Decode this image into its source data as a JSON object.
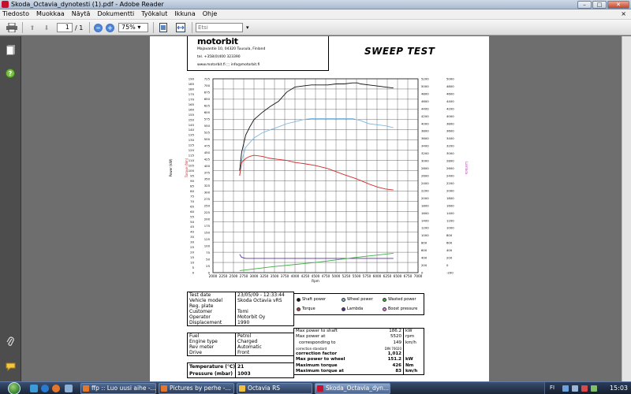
{
  "window": {
    "title": "Skoda_Octavia_dynotesti (1).pdf - Adobe Reader",
    "min": "–",
    "max": "□",
    "close": "✕"
  },
  "menubar": {
    "items": [
      "Tiedosto",
      "Muokkaa",
      "Näytä",
      "Dokumentti",
      "Työkalut",
      "Ikkuna",
      "Ohje"
    ],
    "close": "×"
  },
  "toolbar": {
    "page_current": "1",
    "page_total": "/ 1",
    "zoom": "75%",
    "search_placeholder": "Etsi"
  },
  "doc": {
    "logo": "motorbit",
    "address": "Majavantie 10, 04320 Tuusula, Finland",
    "phone": "tel. +358(0)400 323390",
    "web": "www.motorbit.fi  ⬚  info@motorbit.fi",
    "sweep_title": "SWEEP TEST"
  },
  "chart_data": {
    "type": "line",
    "xlabel": "Rpm",
    "x_ticks": [
      2000,
      2250,
      2500,
      2750,
      3000,
      3250,
      3500,
      3750,
      4000,
      4250,
      4500,
      4750,
      5000,
      5250,
      5500,
      5750,
      6000,
      6250,
      6500,
      6750,
      7000
    ],
    "xlim": [
      2000,
      7000
    ],
    "y1_label": "Power (kW)",
    "y1_ticks": [
      0,
      5,
      10,
      15,
      20,
      25,
      30,
      35,
      40,
      45,
      50,
      55,
      60,
      65,
      70,
      75,
      80,
      85,
      90,
      95,
      100,
      105,
      110,
      115,
      120,
      125,
      130,
      135,
      140,
      145,
      150,
      155,
      160,
      165,
      170,
      175,
      180,
      185,
      190
    ],
    "y2_label": "Torque (Nm)",
    "y2_ticks": [
      0,
      25,
      50,
      75,
      100,
      125,
      150,
      175,
      200,
      225,
      250,
      275,
      300,
      325,
      350,
      375,
      400,
      425,
      450,
      475,
      500,
      525,
      550,
      575,
      600,
      625,
      650,
      675,
      700,
      725
    ],
    "y3_ticks": [
      5200,
      5000,
      4800,
      4600,
      4400,
      4200,
      4000,
      3800,
      3600,
      3400,
      3200,
      3000,
      2800,
      2600,
      2400,
      2200,
      2000,
      1800,
      1600,
      1400,
      1200,
      1000,
      800,
      600,
      400,
      200,
      0
    ],
    "y4_label": "Lambda",
    "y4_ticks": [
      5000,
      4800,
      4600,
      4400,
      4200,
      4000,
      3800,
      3600,
      3400,
      3200,
      3000,
      2800,
      2600,
      2400,
      2200,
      2000,
      1800,
      1600,
      1400,
      1200,
      1000,
      800,
      600,
      400,
      200,
      0,
      -200
    ],
    "ylim": [
      0,
      190
    ],
    "series": [
      {
        "name": "Shaft power",
        "color": "#111111",
        "x": [
          2650,
          2700,
          2800,
          2900,
          3000,
          3200,
          3400,
          3600,
          3800,
          4000,
          4200,
          4400,
          4600,
          4800,
          5000,
          5200,
          5400,
          5520,
          5600,
          5800,
          6000,
          6200,
          6400
        ],
        "y": [
          100,
          118,
          135,
          143,
          150,
          157,
          163,
          168,
          177,
          182,
          183,
          184,
          184,
          184,
          185,
          185,
          186,
          186,
          185,
          184,
          183,
          182,
          181
        ]
      },
      {
        "name": "Wheel power",
        "color": "#7fb8de",
        "x": [
          2650,
          2700,
          2800,
          3000,
          3200,
          3400,
          3600,
          3800,
          4000,
          4200,
          4400,
          4600,
          4800,
          5000,
          5200,
          5400,
          5600,
          5800,
          6000,
          6200,
          6400
        ],
        "y": [
          95,
          110,
          123,
          132,
          137,
          140,
          143,
          146,
          148,
          150,
          151,
          151,
          151,
          151,
          151,
          151,
          149,
          146,
          145,
          144,
          142
        ]
      },
      {
        "name": "Torque",
        "color": "#d42a2a",
        "x": [
          2650,
          2700,
          2800,
          2900,
          3000,
          3200,
          3400,
          3600,
          3800,
          4000,
          4200,
          4500,
          4800,
          5000,
          5200,
          5500,
          5800,
          6000,
          6200,
          6400
        ],
        "y": [
          95,
          108,
          112,
          114,
          115,
          114,
          112,
          111,
          110,
          108,
          107,
          105,
          102,
          99,
          96,
          92,
          87,
          84,
          82,
          81
        ]
      },
      {
        "name": "Lambda",
        "color": "#5a2fa0",
        "x": [
          2650,
          2700,
          2800,
          3000,
          3500,
          4000,
          5000,
          6000,
          6400
        ],
        "y": [
          18,
          15,
          14,
          14,
          14,
          14,
          14,
          14,
          14
        ]
      },
      {
        "name": "Wasted power",
        "color": "#3fae3f",
        "x": [
          2650,
          3500,
          4500,
          5500,
          6400
        ],
        "y": [
          2,
          6,
          10,
          15,
          19
        ]
      }
    ]
  },
  "legend": {
    "shaft": "Shaft power",
    "wheel": "Wheel power",
    "wasted": "Wasted power",
    "torque": "Torque",
    "lambda": "Lambda",
    "boost": "Boost pressure"
  },
  "info": {
    "rows": [
      {
        "k": "Test date",
        "v": "23/05/09 - 12:33:44"
      },
      {
        "k": "Vehicle model",
        "v": "Skoda Octavia vRS"
      },
      {
        "k": "Reg. plate",
        "v": ""
      },
      {
        "k": "Customer",
        "v": "Tomi"
      },
      {
        "k": "Operator",
        "v": "Motorbit Oy"
      },
      {
        "k": "Displacement",
        "v": "1990"
      }
    ],
    "rows2": [
      {
        "k": "Fuel",
        "v": "Petrol"
      },
      {
        "k": "Engine type",
        "v": "Charged"
      },
      {
        "k": "Rev meter",
        "v": "Automatic"
      },
      {
        "k": "Drive",
        "v": "Front"
      }
    ],
    "rows3": [
      {
        "k": "Temperature (°C)",
        "v": "21"
      },
      {
        "k": "Pressure (mbar)",
        "v": "1003"
      }
    ]
  },
  "summary": {
    "rows": [
      {
        "k": "Max power to shaft",
        "v": "186.2",
        "u": "kW"
      },
      {
        "k": "Max power at",
        "v": "5520",
        "u": "rpm"
      },
      {
        "k": "corresponding to",
        "v": "149",
        "u": "km/h"
      },
      {
        "k": "correction standard",
        "v": "DIN 70020",
        "u": ""
      },
      {
        "k": "correction factor",
        "v": "1,012",
        "u": ""
      },
      {
        "k": "Max power to wheel",
        "v": "151.2",
        "u": "kW"
      },
      {
        "k": "Maximum torque",
        "v": "426",
        "u": "Nm"
      },
      {
        "k": "Maximum torque at",
        "v": "83",
        "u": "km/h"
      }
    ]
  },
  "taskbar": {
    "tasks": [
      "ffp :: Luo uusi aihe -...",
      "Pictures by perhe -...",
      "Octavia RS",
      "Skoda_Octavia_dyn..."
    ],
    "lang": "FI",
    "clock": "15:03"
  }
}
